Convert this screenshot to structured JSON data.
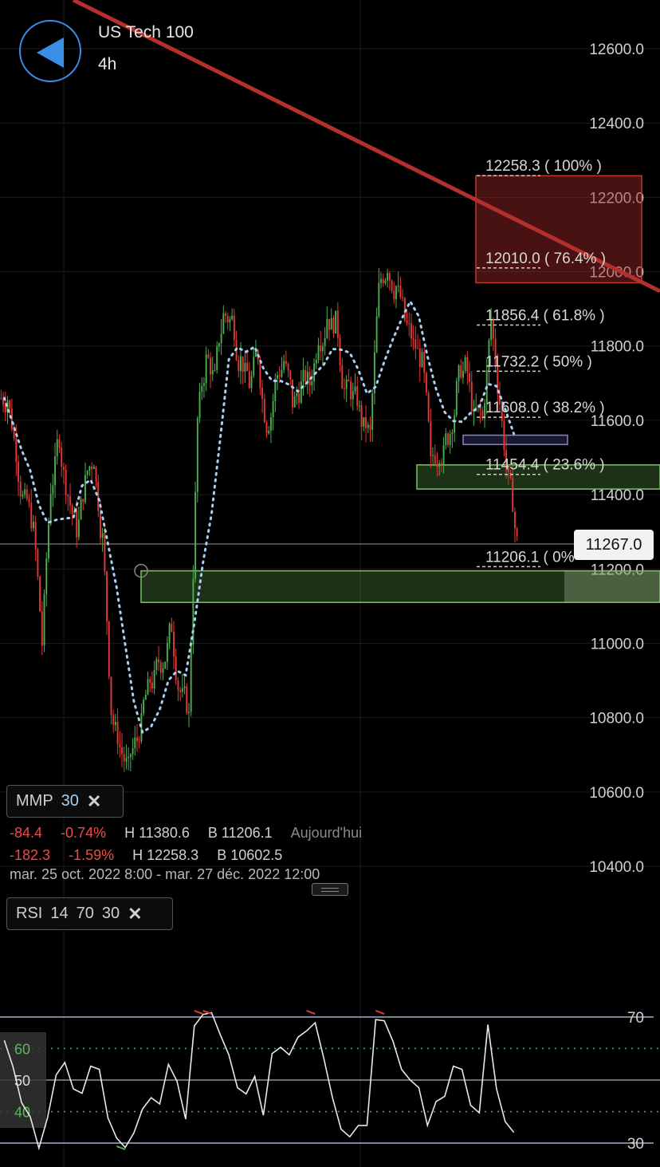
{
  "header": {
    "symbol": "US Tech 100",
    "interval": "4h"
  },
  "price_axis": {
    "labels": [
      "12600.0",
      "12400.0",
      "12200.0",
      "12000.0",
      "11800.0",
      "11600.0",
      "11400.0",
      "11200.0",
      "11000.0",
      "10800.0",
      "10600.0",
      "10400.0"
    ],
    "current_price": "11267.0"
  },
  "fibonacci": [
    {
      "price": 12258.3,
      "label": "12258.3 ( 100% )"
    },
    {
      "price": 12010.0,
      "label": "12010.0 ( 76.4% )"
    },
    {
      "price": 11856.4,
      "label": "11856.4 ( 61.8% )"
    },
    {
      "price": 11732.2,
      "label": "11732.2 ( 50% )"
    },
    {
      "price": 11608.0,
      "label": "11608.0 ( 38.2% )"
    },
    {
      "price": 11454.4,
      "label": "11454.4 ( 23.6% )"
    },
    {
      "price": 11206.1,
      "label": "11206.1 ( 0%"
    }
  ],
  "indicators": {
    "mmp": {
      "name": "MMP",
      "period": "30"
    },
    "rsi": {
      "name": "RSI",
      "length": "14",
      "upper": "70",
      "lower": "30"
    }
  },
  "stats": {
    "today": {
      "change": "-84.4",
      "percent": "-0.74%",
      "high": "H 11380.6",
      "low": "B 11206.1",
      "label": "Aujourd'hui"
    },
    "range": {
      "change": "-182.3",
      "percent": "-1.59%",
      "high": "H 12258.3",
      "low": "B 10602.5"
    },
    "date_range": "mar. 25 oct. 2022 8:00 - mar. 27 déc. 2022 12:00"
  },
  "rsi_axis": {
    "right_labels": [
      "70",
      "30"
    ],
    "left_labels": [
      "60",
      "50",
      "40"
    ]
  },
  "colors": {
    "up": "#4caf50",
    "down": "#e53935",
    "trendline": "#b3302b",
    "ma": "#a9cff0",
    "accent": "#3b8ee6"
  },
  "chart_data": {
    "type": "candlestick",
    "symbol": "US Tech 100",
    "timeframe": "4h",
    "ylim": [
      10400,
      12650
    ],
    "current_price": 11267.0,
    "closes": [
      11660,
      11520,
      11380,
      11300,
      11000,
      11420,
      11560,
      11400,
      11310,
      11430,
      11500,
      11280,
      10820,
      10720,
      10660,
      10740,
      10860,
      10900,
      10950,
      11050,
      10870,
      10800,
      11600,
      11760,
      11710,
      11880,
      11870,
      11760,
      11700,
      11780,
      11590,
      11700,
      11760,
      11650,
      11690,
      11700,
      11830,
      11880,
      11860,
      11680,
      11660,
      11600,
      11560,
      11950,
      12020,
      11960,
      11870,
      11800,
      11750,
      11480,
      11520,
      11560,
      11680,
      11740,
      11600,
      11600,
      11870,
      11650,
      11430,
      11270
    ],
    "moving_average": {
      "name": "MMP",
      "period": 30
    },
    "fibonacci_levels": [
      {
        "ratio": "100%",
        "price": 12258.3
      },
      {
        "ratio": "76.4%",
        "price": 12010.0
      },
      {
        "ratio": "61.8%",
        "price": 11856.4
      },
      {
        "ratio": "50%",
        "price": 11732.2
      },
      {
        "ratio": "38.2%",
        "price": 11608.0
      },
      {
        "ratio": "23.6%",
        "price": 11454.4
      },
      {
        "ratio": "0%",
        "price": 11206.1
      }
    ],
    "zones": [
      {
        "color": "red",
        "from": 11970,
        "to": 12258
      },
      {
        "color": "green",
        "from": 11415,
        "to": 11480
      },
      {
        "color": "green",
        "from": 11110,
        "to": 11195
      },
      {
        "color": "purple",
        "from": 11535,
        "to": 11560
      }
    ],
    "rsi": {
      "length": 14,
      "upper": 70,
      "lower": 30,
      "ylim": [
        28,
        72
      ],
      "values": [
        65,
        55,
        42,
        36,
        30,
        38,
        50,
        58,
        48,
        45,
        52,
        55,
        38,
        30,
        31,
        34,
        40,
        42,
        44,
        55,
        48,
        40,
        68,
        70,
        69,
        66,
        58,
        46,
        48,
        52,
        38,
        56,
        62,
        58,
        62,
        68,
        69,
        56,
        42,
        36,
        32,
        34,
        38,
        70,
        68,
        60,
        55,
        50,
        46,
        38,
        44,
        44,
        52,
        55,
        42,
        38,
        70,
        48,
        36,
        31
      ]
    },
    "grid": true
  }
}
